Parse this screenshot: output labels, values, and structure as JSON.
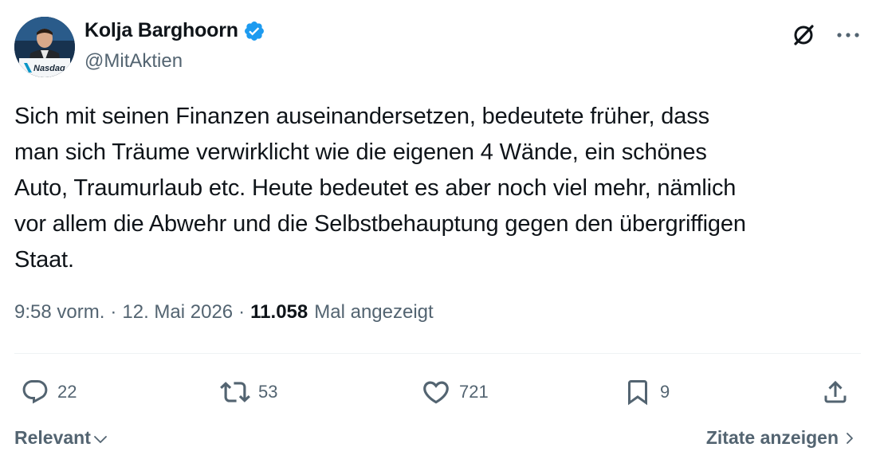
{
  "author": {
    "display_name": "Kolja Barghoorn",
    "handle": "@MitAktien",
    "avatar_badge_text": "Nasdaq"
  },
  "tweet": {
    "text": "Sich mit seinen Finanzen auseinandersetzen, bedeutete früher, dass\nman sich Träume verwirklicht wie die eigenen 4 Wände, ein schönes\nAuto, Traumurlaub etc. Heute bedeutet es aber noch viel mehr, nämlich\nvor allem die Abwehr und die Selbstbehauptung gegen den übergriffigen\nStaat."
  },
  "meta": {
    "time": "9:58 vorm.",
    "separator": "·",
    "date": "12. Mai 2026",
    "views_count": "11.058",
    "views_label": "Mal angezeigt"
  },
  "actions": {
    "replies": "22",
    "reposts": "53",
    "likes": "721",
    "bookmarks": "9"
  },
  "footer": {
    "sort_label": "Relevant",
    "quotes_label": "Zitate anzeigen"
  },
  "colors": {
    "text_primary": "#0f1419",
    "text_secondary": "#536471",
    "verified_blue": "#1d9bf0",
    "divider": "#eff3f4"
  }
}
